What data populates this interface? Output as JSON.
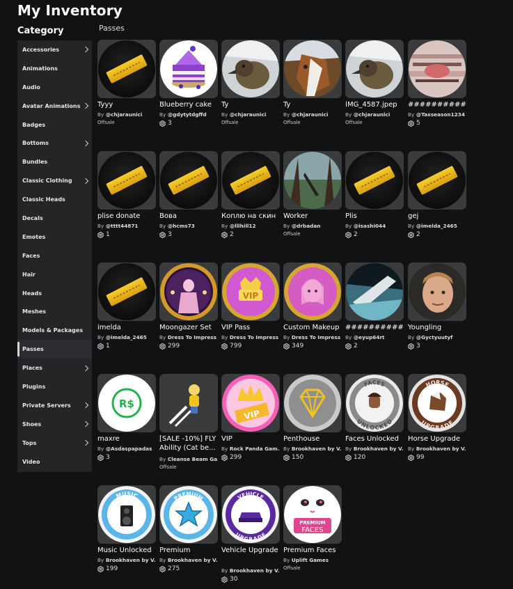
{
  "header": {
    "title": "My Inventory"
  },
  "sidebar": {
    "title": "Category",
    "items": [
      {
        "label": "Accessories",
        "chevron": true,
        "active": false
      },
      {
        "label": "Animations",
        "chevron": false,
        "active": false
      },
      {
        "label": "Audio",
        "chevron": false,
        "active": false
      },
      {
        "label": "Avatar Animations",
        "chevron": true,
        "active": false
      },
      {
        "label": "Badges",
        "chevron": false,
        "active": false
      },
      {
        "label": "Bottoms",
        "chevron": true,
        "active": false
      },
      {
        "label": "Bundles",
        "chevron": false,
        "active": false
      },
      {
        "label": "Classic Clothing",
        "chevron": true,
        "active": false
      },
      {
        "label": "Classic Heads",
        "chevron": false,
        "active": false
      },
      {
        "label": "Decals",
        "chevron": false,
        "active": false
      },
      {
        "label": "Emotes",
        "chevron": false,
        "active": false
      },
      {
        "label": "Faces",
        "chevron": false,
        "active": false
      },
      {
        "label": "Hair",
        "chevron": false,
        "active": false
      },
      {
        "label": "Heads",
        "chevron": false,
        "active": false
      },
      {
        "label": "Meshes",
        "chevron": false,
        "active": false
      },
      {
        "label": "Models & Packages",
        "chevron": false,
        "active": false
      },
      {
        "label": "Passes",
        "chevron": false,
        "active": true
      },
      {
        "label": "Places",
        "chevron": true,
        "active": false
      },
      {
        "label": "Plugins",
        "chevron": false,
        "active": false
      },
      {
        "label": "Private Servers",
        "chevron": true,
        "active": false
      },
      {
        "label": "Shoes",
        "chevron": true,
        "active": false
      },
      {
        "label": "Tops",
        "chevron": true,
        "active": false
      },
      {
        "label": "Video",
        "chevron": false,
        "active": false
      }
    ]
  },
  "main": {
    "section_title": "Passes",
    "by_label": "By",
    "offsale_label": "Offsale",
    "items": [
      {
        "name": "Tyyy",
        "creator": "@chjaraunici",
        "price": null,
        "thumb": "ticket"
      },
      {
        "name": "Blueberry cake",
        "creator": "@gdytytdgffd",
        "price": "3",
        "thumb": "cake"
      },
      {
        "name": "Ty",
        "creator": "@chjaraunici",
        "price": null,
        "thumb": "duck"
      },
      {
        "name": "Ty",
        "creator": "@chjaraunici",
        "price": null,
        "thumb": "goat"
      },
      {
        "name": "IMG_4587.jpep",
        "creator": "@chjaraunici",
        "price": null,
        "thumb": "duck"
      },
      {
        "name": "############",
        "creator": "@Taxseason1234",
        "price": "5",
        "thumb": "glitch"
      },
      {
        "name": "plise donate",
        "creator": "@tttt44871",
        "price": "1",
        "thumb": "ticket"
      },
      {
        "name": "Вова",
        "creator": "@hcms73",
        "price": "3",
        "thumb": "ticket"
      },
      {
        "name": "Коплю на скин",
        "creator": "@lllhill12",
        "price": "2",
        "thumb": "ticket"
      },
      {
        "name": "Worker",
        "creator": "@drbadan",
        "price": null,
        "thumb": "forest"
      },
      {
        "name": "Plis",
        "creator": "@isashi044",
        "price": "2",
        "thumb": "ticket"
      },
      {
        "name": "gej",
        "creator": "@imelda_2465",
        "price": "2",
        "thumb": "ticket"
      },
      {
        "name": "imelda",
        "creator": "@imelda_2465",
        "price": "1",
        "thumb": "ticket"
      },
      {
        "name": "Moongazer Set",
        "creator": "Dress To Impress ...",
        "price": "299",
        "thumb": "moongazer"
      },
      {
        "name": "VIP Pass",
        "creator": "Dress To Impress ...",
        "price": "799",
        "thumb": "vippass"
      },
      {
        "name": "Custom Makeup",
        "creator": "Dress To Impress ...",
        "price": "349",
        "thumb": "makeup"
      },
      {
        "name": "##########",
        "creator": "@eyup64rt",
        "price": "2",
        "thumb": "ship"
      },
      {
        "name": "Youngling",
        "creator": "@Gyctyuutyf",
        "price": "3",
        "thumb": "boy"
      },
      {
        "name": "maxre",
        "creator": "@Asdaspapadas",
        "price": "3",
        "thumb": "robux"
      },
      {
        "name": "[SALE -10%] FLY Ability (Cat be...",
        "creator": "Cleanse Beam Ga...",
        "price": null,
        "thumb": "fly",
        "wrap": true
      },
      {
        "name": "VIP",
        "creator": "Rock Panda Gam...",
        "price": "299",
        "thumb": "vip"
      },
      {
        "name": "Penthouse",
        "creator": "Brookhaven by V...",
        "price": "150",
        "thumb": "diamond"
      },
      {
        "name": "Faces Unlocked",
        "creator": "Brookhaven by V...",
        "price": "120",
        "thumb": "faces"
      },
      {
        "name": "Horse Upgrade",
        "creator": "Brookhaven by V...",
        "price": "99",
        "thumb": "horse"
      },
      {
        "name": "Music Unlocked",
        "creator": "Brookhaven by V...",
        "price": "199",
        "thumb": "music"
      },
      {
        "name": "Premium",
        "creator": "Brookhaven by V...",
        "price": "275",
        "thumb": "premium"
      },
      {
        "name": "Vehicle Upgrade",
        "creator": "Brookhaven by V...",
        "price": "30",
        "thumb": "vehicle",
        "wrap": true
      },
      {
        "name": "Premium Faces",
        "creator": "Uplift Games",
        "price": null,
        "thumb": "premfaces"
      }
    ],
    "thumb_text": {
      "faces": [
        "FACES",
        "UNLOCKED"
      ],
      "horse": [
        "HORSE",
        "UPGRADE"
      ],
      "music": [
        "MUSIC"
      ],
      "premium": [
        "PREMIUM"
      ],
      "vehicle": [
        "VEHICLE",
        "UPGRADE"
      ],
      "premfaces": [
        "PREMIUM",
        "FACES"
      ],
      "vip": [
        "VIP"
      ],
      "vippass": [
        "VIP"
      ],
      "robux": [
        "R$"
      ]
    }
  }
}
